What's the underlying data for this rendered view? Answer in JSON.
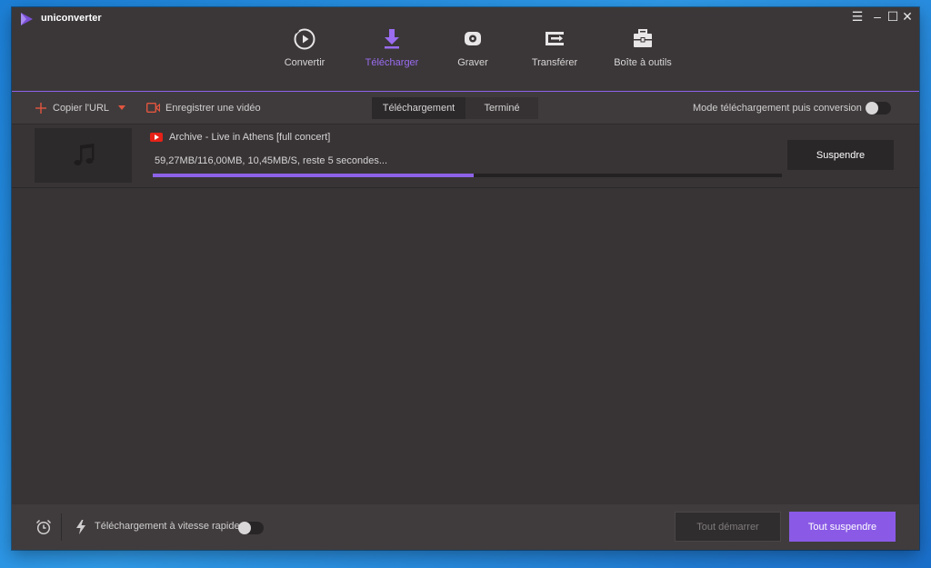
{
  "app": {
    "title": "uniconverter",
    "accent_color": "#8a5ae6"
  },
  "nav": {
    "items": [
      {
        "label": "Convertir",
        "icon": "convert-icon"
      },
      {
        "label": "Télécharger",
        "icon": "download-icon",
        "active": true
      },
      {
        "label": "Graver",
        "icon": "burn-disc-icon"
      },
      {
        "label": "Transférer",
        "icon": "transfer-icon"
      },
      {
        "label": "Boîte à outils",
        "icon": "toolbox-icon"
      }
    ]
  },
  "toolbar": {
    "copy_url": "Copier l'URL",
    "record_video": "Enregistrer une vidéo",
    "tab_downloading": "Téléchargement",
    "tab_finished": "Terminé",
    "mode_label": "Mode téléchargement puis conversion",
    "mode_enabled": false
  },
  "downloads": [
    {
      "source": "youtube",
      "title": "Archive - Live in Athens [full concert]",
      "status": "59,27MB/116,00MB, 10,45MB/S, reste 5 secondes...",
      "progress": 0.51,
      "action_label": "Suspendre"
    }
  ],
  "footer": {
    "fast_download_label": "Téléchargement à vitesse rapide",
    "fast_download_enabled": false,
    "start_all": "Tout démarrer",
    "pause_all": "Tout suspendre"
  }
}
